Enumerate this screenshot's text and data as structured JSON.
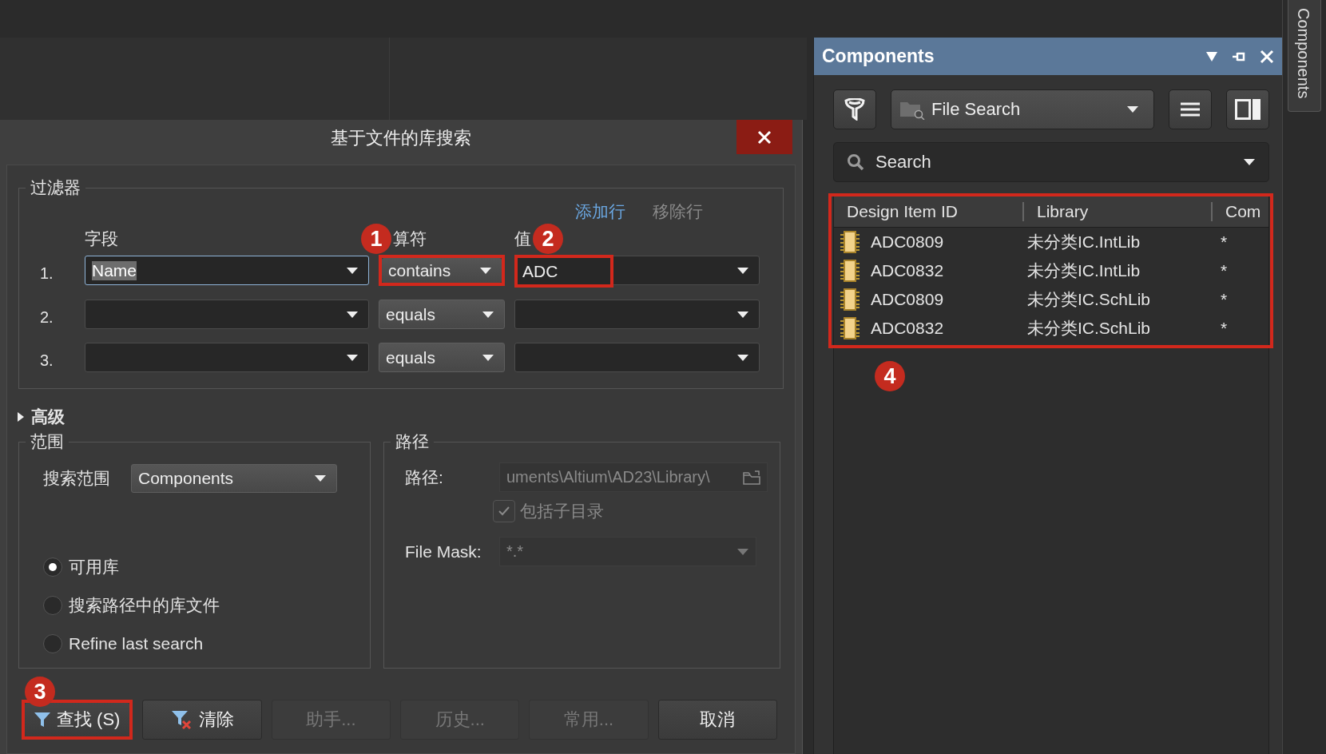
{
  "dialog": {
    "title": "基于文件的库搜索",
    "filter": {
      "title": "过滤器",
      "actions": [
        {
          "label": "添加行",
          "disabled": false
        },
        {
          "label": "移除行",
          "disabled": true
        }
      ],
      "headers": [
        {
          "label": "字段"
        },
        {
          "label": "算符",
          "badge": "1"
        },
        {
          "label": "值",
          "badge": "2"
        }
      ],
      "rows": [
        {
          "number": "1.",
          "field": {
            "value": "Name",
            "focused": true
          },
          "operator": {
            "value": "contains",
            "highlighted": true
          },
          "value": {
            "value": "ADC",
            "highlighted": true
          }
        },
        {
          "number": "2.",
          "field": {
            "focused": false
          },
          "operator": {
            "value": "equals",
            "highlighted": false
          },
          "value": {
            "highlighted": false
          }
        },
        {
          "number": "3.",
          "field": {
            "focused": false
          },
          "operator": {
            "value": "equals",
            "highlighted": false
          },
          "value": {
            "highlighted": false
          }
        }
      ]
    },
    "advanced": {
      "label": "高级",
      "expanded": false
    },
    "scope": {
      "title": "范围",
      "search_label": "搜索范围",
      "search_in": "Components",
      "options": [
        {
          "label": "可用库",
          "selected": true
        },
        {
          "label": "搜索路径中的库文件",
          "selected": false
        },
        {
          "label": "Refine last search",
          "selected": false
        }
      ]
    },
    "path": {
      "title": "路径",
      "path_label": "路径:",
      "path_value": "uments\\Altium\\AD23\\Library\\",
      "include_subdirs": {
        "label": "包括子目录",
        "checked": true,
        "disabled": true
      },
      "mask_label": "File Mask:",
      "mask_value": "*.*"
    },
    "buttons": [
      {
        "label": "查找 (S)",
        "kind": "search",
        "disabled": false,
        "highlighted": true,
        "badge": "3"
      },
      {
        "label": "清除",
        "kind": "clear",
        "disabled": false,
        "highlighted": false
      },
      {
        "label": "助手...",
        "kind": "plain",
        "disabled": true,
        "highlighted": false
      },
      {
        "label": "历史...",
        "kind": "plain",
        "disabled": true,
        "highlighted": false
      },
      {
        "label": "常用...",
        "kind": "plain",
        "disabled": true,
        "highlighted": false
      },
      {
        "label": "取消",
        "kind": "cancel",
        "disabled": false,
        "highlighted": false
      }
    ]
  },
  "components_panel": {
    "title": "Components",
    "source": "File Search",
    "search_placeholder": "Search",
    "results": {
      "highlighted": true,
      "badge": "4",
      "columns": [
        "Design Item ID",
        "Library",
        "Com"
      ],
      "rows": [
        {
          "design_item_id": "ADC0809",
          "library": "未分类IC.IntLib",
          "column_3": "*"
        },
        {
          "design_item_id": "ADC0832",
          "library": "未分类IC.IntLib",
          "column_3": "*"
        },
        {
          "design_item_id": "ADC0809",
          "library": "未分类IC.SchLib",
          "column_3": "*"
        },
        {
          "design_item_id": "ADC0832",
          "library": "未分类IC.SchLib",
          "column_3": "*"
        }
      ]
    }
  },
  "side_tab": {
    "label": "Components"
  }
}
